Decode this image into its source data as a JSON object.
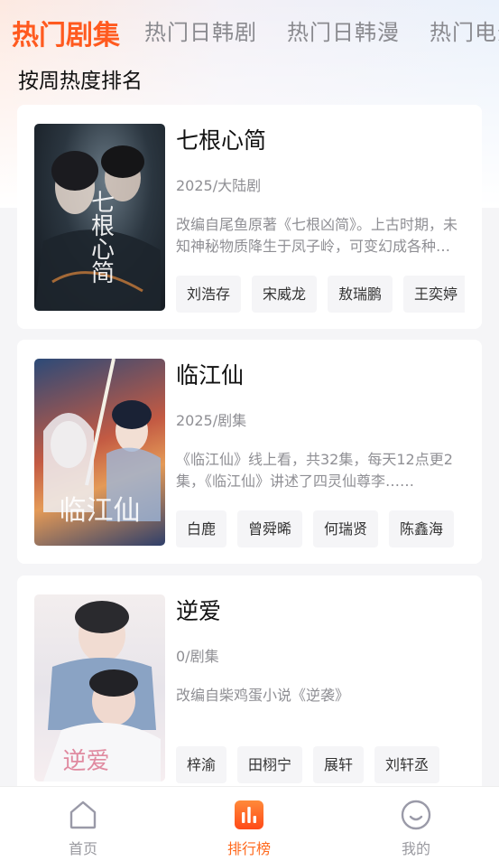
{
  "tabs": [
    {
      "label": "热门剧集",
      "active": true
    },
    {
      "label": "热门日韩剧",
      "active": false
    },
    {
      "label": "热门日韩漫",
      "active": false
    },
    {
      "label": "热门电影",
      "active": false
    }
  ],
  "section_title": "按周热度排名",
  "items": [
    {
      "title": "七根心简",
      "poster_title": "七根心简",
      "meta": "2025/大陆剧",
      "description": "改编自尾鱼原著《七根凶简》。上古时期，未知神秘物质降生于凤子岭，可变幻成各种形态，操控人心……",
      "tags": [
        "刘浩存",
        "宋威龙",
        "敖瑞鹏",
        "王奕婷"
      ]
    },
    {
      "title": "临江仙",
      "poster_title": "临江仙",
      "meta": "2025/剧集",
      "description": "《临江仙》线上看，共32集，每天12点更2集，《临江仙》讲述了四灵仙尊李……",
      "tags": [
        "白鹿",
        "曾舜晞",
        "何瑞贤",
        "陈鑫海"
      ]
    },
    {
      "title": "逆爱",
      "poster_title": "逆爱",
      "meta": "0/剧集",
      "description": "改编自柴鸡蛋小说《逆袭》",
      "tags": [
        "梓渝",
        "田栩宁",
        "展轩",
        "刘轩丞"
      ]
    }
  ],
  "nav": [
    {
      "label": "首页",
      "icon": "home-icon",
      "active": false
    },
    {
      "label": "排行榜",
      "icon": "ranking-icon",
      "active": true
    },
    {
      "label": "我的",
      "icon": "profile-icon",
      "active": false
    }
  ],
  "colors": {
    "accent": "#ff5a1f",
    "muted": "#8f8f94"
  }
}
